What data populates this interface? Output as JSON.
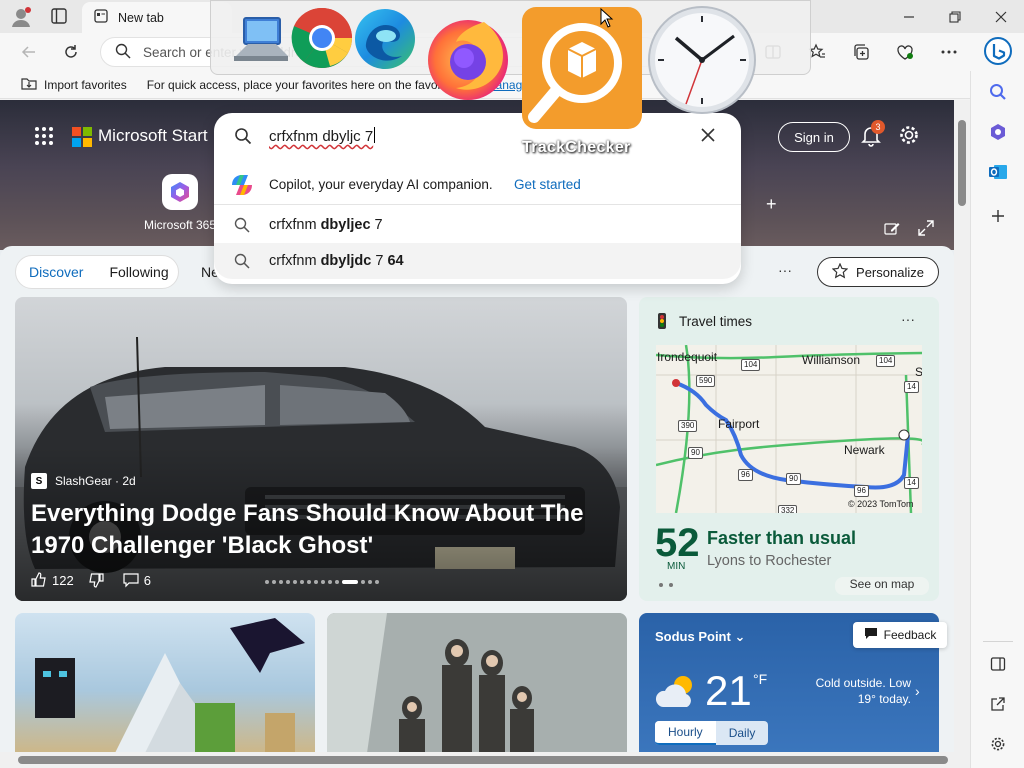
{
  "browser": {
    "tab_title": "New tab",
    "address_placeholder": "Search or enter web address",
    "favorites_import": "Import favorites",
    "favorites_hint": "For quick access, place your favorites here on the favorites bar.",
    "favorites_manage": "Manage favorites now"
  },
  "hero": {
    "brand": "Microsoft Start",
    "m365_label": "Microsoft 365",
    "sign_in": "Sign in",
    "notification_count": "3"
  },
  "search": {
    "query": "crfxfnm dbyljc 7",
    "copilot_text": "Copilot, your everyday AI companion.",
    "copilot_link": "Get started",
    "suggestions": [
      {
        "prefix": "crfxfnm ",
        "bold": "dbyljec",
        "suffix": " 7",
        "bold2": ""
      },
      {
        "prefix": "crfxfnm ",
        "bold": "dbyljdc",
        "suffix": " 7 ",
        "bold2": "64"
      }
    ]
  },
  "feed": {
    "tabs": [
      "Discover",
      "Following"
    ],
    "next_tab": "Ne",
    "personalize": "Personalize"
  },
  "main_story": {
    "source": "SlashGear · 2d",
    "headline": "Everything Dodge Fans Should Know About The 1970 Challenger 'Black Ghost'",
    "likes": "122",
    "dislikes": "",
    "comments": "6"
  },
  "travel": {
    "title": "Travel times",
    "minutes": "52",
    "minutes_unit": "MIN",
    "status": "Faster than usual",
    "route": "Lyons to Rochester",
    "see_map": "See on map",
    "map_labels": {
      "irondequoit": "Irondequoit",
      "williamson": "Williamson",
      "fairport": "Fairport",
      "newark": "Newark",
      "copyright": "© 2023 TomTom",
      "s": "S"
    },
    "shields": [
      "104",
      "590",
      "104",
      "14",
      "390",
      "90",
      "96",
      "90",
      "96",
      "14",
      "332"
    ]
  },
  "weather": {
    "location": "Sodus Point",
    "temp": "21",
    "unit": "°F",
    "condition": "Cold outside. Low 19° today.",
    "tabs": [
      "Hourly",
      "Daily"
    ]
  },
  "feedback": "Feedback",
  "switcher": {
    "trackchecker_label": "TrackChecker"
  }
}
